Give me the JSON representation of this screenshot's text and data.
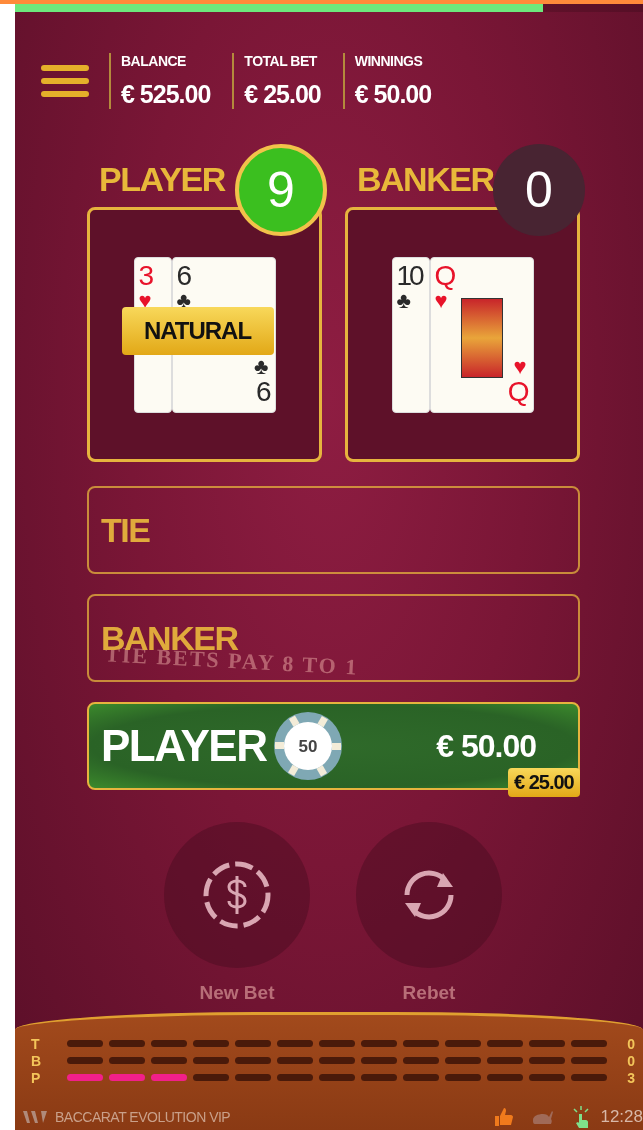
{
  "progress": {
    "level": 0.84
  },
  "header": {
    "stats": [
      {
        "label": "BALANCE",
        "value": "€ 525.00"
      },
      {
        "label": "TOTAL BET",
        "value": "€ 25.00"
      },
      {
        "label": "WINNINGS",
        "value": "€ 50.00"
      }
    ]
  },
  "hands": [
    {
      "title": "PLAYER",
      "score": "9",
      "winner": true,
      "badge": "NATURAL",
      "cards": [
        {
          "rank": "3",
          "suit": "♥",
          "color": "#e8132a",
          "kind": "number"
        },
        {
          "rank": "6",
          "suit": "♣",
          "color": "#2a2a2a",
          "kind": "number",
          "corner_rank": "6",
          "corner_suit": "♣"
        }
      ]
    },
    {
      "title": "BANKER",
      "score": "0",
      "winner": false,
      "cards": [
        {
          "rank": "10",
          "suit": "♣",
          "color": "#2a2a2a",
          "kind": "number"
        },
        {
          "rank": "Q",
          "suit": "♥",
          "color": "#e8132a",
          "kind": "face",
          "corner_rank": "Q",
          "corner_suit": "♥"
        }
      ]
    }
  ],
  "table_text": "TIE BETS PAY 8 TO 1",
  "bets": [
    {
      "label": "TIE",
      "selected": false
    },
    {
      "label": "BANKER",
      "selected": false
    },
    {
      "label": "PLAYER",
      "selected": true,
      "chip": "50",
      "amount": "€ 50.00",
      "win": "€ 25.00"
    }
  ],
  "actions": [
    {
      "label": "New Bet",
      "kind": "newbet"
    },
    {
      "label": "Rebet",
      "kind": "rebet"
    }
  ],
  "roadmap": [
    {
      "label": "T",
      "count": "0",
      "marks": [
        false,
        false,
        false,
        false,
        false,
        false,
        false,
        false,
        false,
        false,
        false,
        false,
        false
      ]
    },
    {
      "label": "B",
      "count": "0",
      "marks": [
        false,
        false,
        false,
        false,
        false,
        false,
        false,
        false,
        false,
        false,
        false,
        false,
        false
      ]
    },
    {
      "label": "P",
      "count": "3",
      "marks": [
        true,
        true,
        true,
        false,
        false,
        false,
        false,
        false,
        false,
        false,
        false,
        false,
        false
      ]
    }
  ],
  "footer": {
    "title": "BACCARAT EVOLUTION VIP",
    "time": "12:28"
  }
}
